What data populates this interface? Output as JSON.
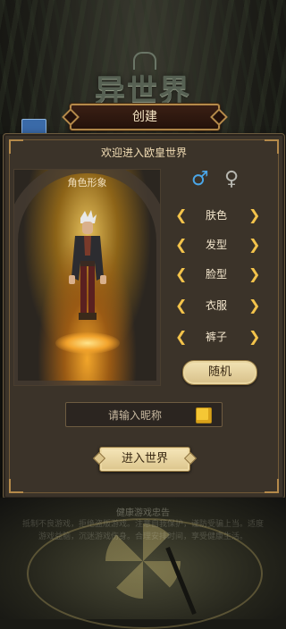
{
  "logo": {
    "text": "异世界"
  },
  "header": {
    "title": "创建"
  },
  "panel": {
    "welcome": "欢迎进入欧皇世界",
    "portrait_label": "角色形象",
    "gender": {
      "male": "♂",
      "female": "♀"
    },
    "options": [
      {
        "label": "肤色"
      },
      {
        "label": "发型"
      },
      {
        "label": "脸型"
      },
      {
        "label": "衣服"
      },
      {
        "label": "裤子"
      }
    ],
    "arrow_left": "❮",
    "arrow_right": "❯",
    "random_label": "随机",
    "nickname_placeholder": "请输入昵称",
    "enter_label": "进入世界"
  },
  "footer": {
    "notice_title": "健康游戏忠告",
    "notice_body": "抵制不良游戏，拒绝盗版游戏。注意自我保护，谨防受骗上当。适度游戏益脑，沉迷游戏伤身。合理安排时间，享受健康生活。"
  },
  "colors": {
    "accent": "#b58a4a",
    "gold": "#f3c34b",
    "male": "#4aa6e8"
  }
}
